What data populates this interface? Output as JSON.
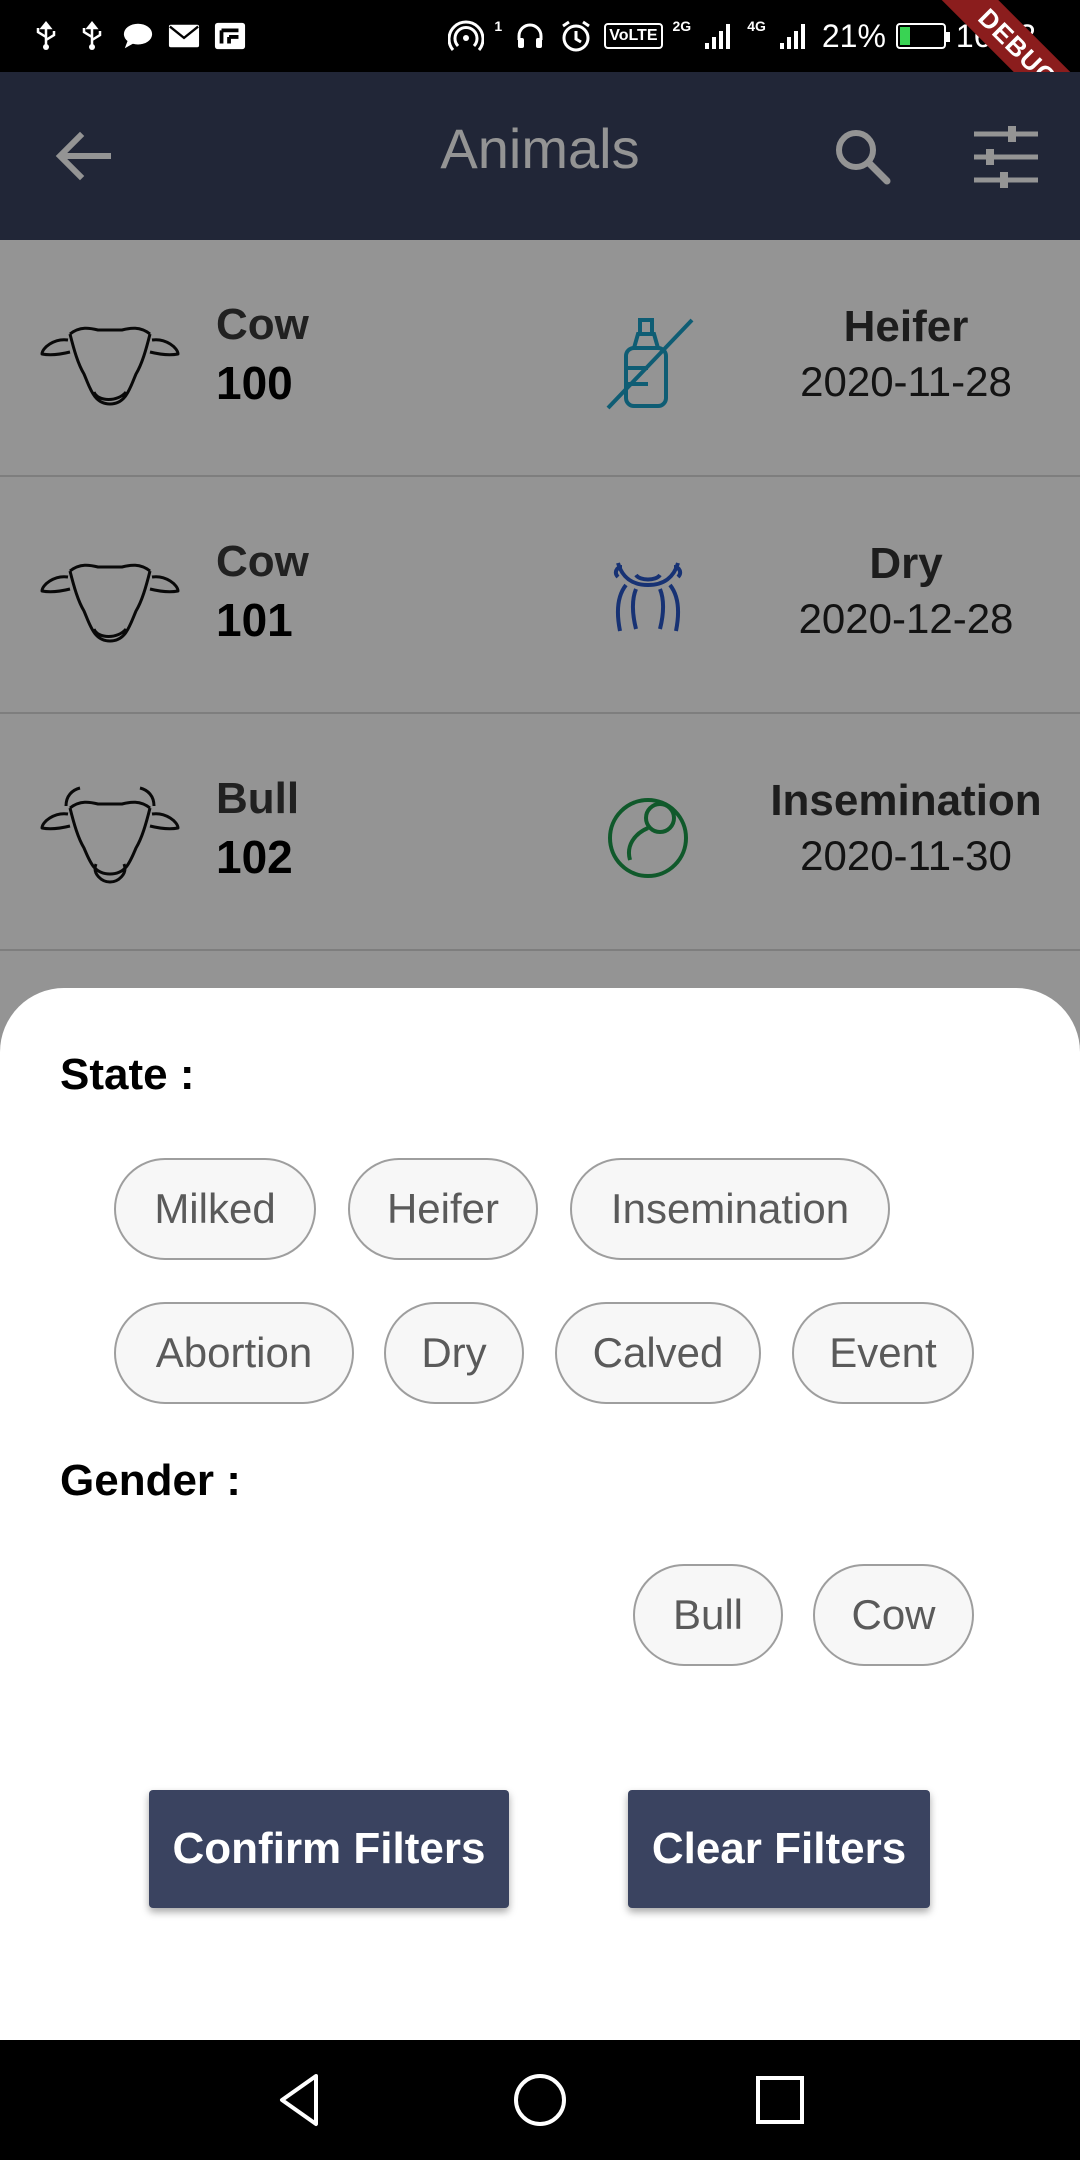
{
  "status_bar": {
    "battery_percent": "21%",
    "battery_level": 0.21,
    "network_2g": "2G",
    "network_4g": "4G",
    "volte": "VoLTE",
    "sim_index": "1",
    "time": "16:43",
    "debug_label": "DEBUG"
  },
  "app_bar": {
    "title": "Animals",
    "back_icon": "arrow-back-icon",
    "search_icon": "search-icon",
    "filter_icon": "tune-icon"
  },
  "animals": [
    {
      "type": "Cow",
      "number": "100",
      "state": "Heifer",
      "date": "2020-11-28",
      "state_icon": "no-bottle-icon",
      "state_color": "#1ba0c8"
    },
    {
      "type": "Cow",
      "number": "101",
      "state": "Dry",
      "date": "2020-12-28",
      "state_icon": "udder-icon",
      "state_color": "#2856c8"
    },
    {
      "type": "Bull",
      "number": "102",
      "state": "Insemination",
      "date": "2020-11-30",
      "state_icon": "sperm-icon",
      "state_color": "#1c9a4a"
    }
  ],
  "filter_sheet": {
    "state_label": "State :",
    "state_chips": [
      "Milked",
      "Heifer",
      "Insemination",
      "Abortion",
      "Dry",
      "Calved",
      "Event"
    ],
    "gender_label": "Gender :",
    "gender_chips": [
      "Bull",
      "Cow"
    ],
    "confirm_button": "Confirm Filters",
    "clear_button": "Clear Filters"
  },
  "colors": {
    "primary": "#3a4360",
    "chip_border": "#9e9e9e",
    "chip_bg": "#f7f7f7"
  }
}
